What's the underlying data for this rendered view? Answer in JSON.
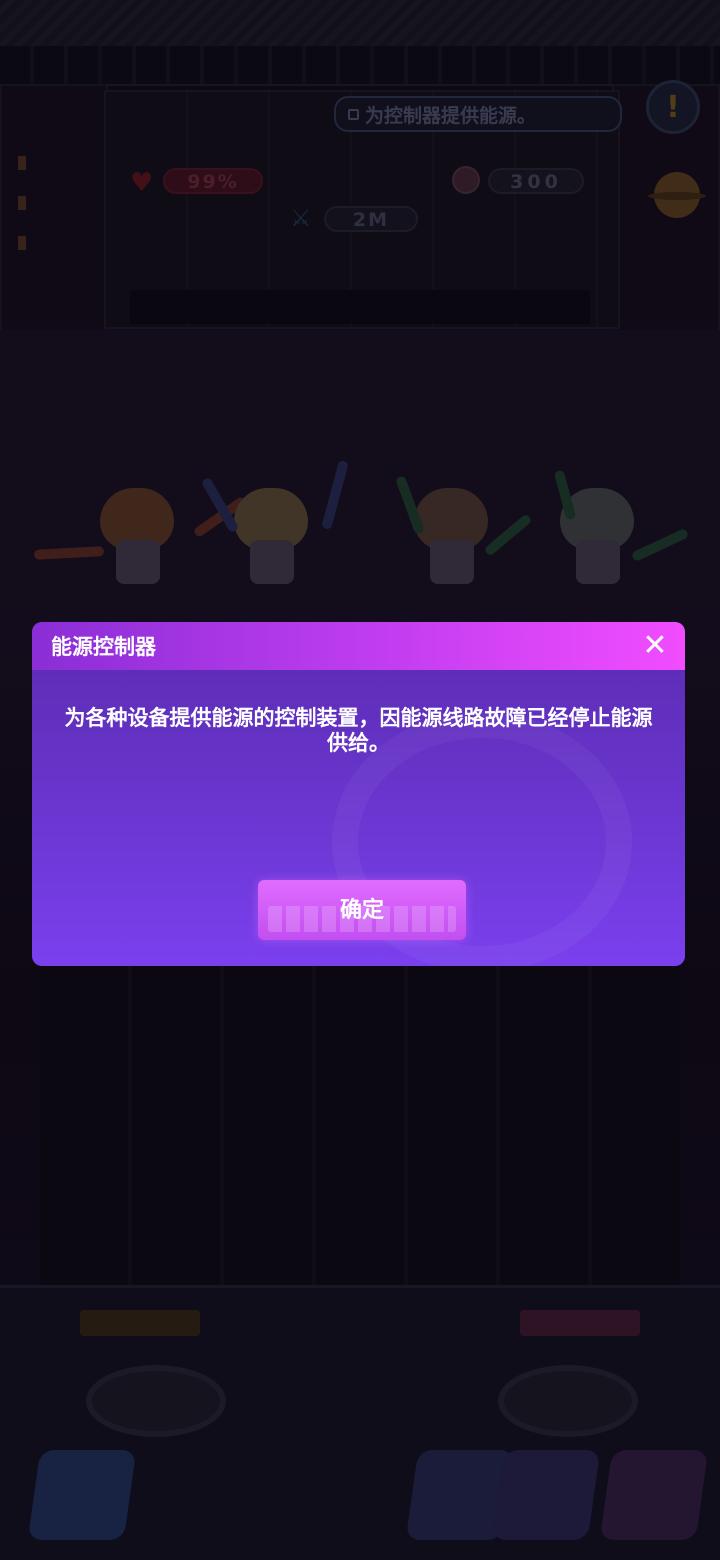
{
  "hud": {
    "quest_text": "为控制器提供能源。",
    "hp": "99%",
    "currency": "300",
    "distance": "2M",
    "alert_symbol": "!"
  },
  "icons": {
    "heart": "♥",
    "sword": "⚔",
    "close": "✕"
  },
  "dialog": {
    "title": "能源控制器",
    "body": "为各种设备提供能源的控制装置，因能源线路故障已经停止能源供给。",
    "confirm_label": "确定"
  },
  "colors": {
    "header_gradient_start": "#8a2ed6",
    "header_gradient_end": "#f24cff",
    "dialog_bg": "#6a36d0",
    "confirm_button": "#d55ef8"
  }
}
